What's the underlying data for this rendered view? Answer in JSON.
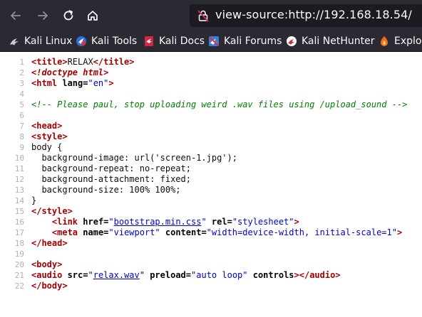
{
  "browser": {
    "url": "view-source:http://192.168.18.54/",
    "icons": {
      "back": "arrow-left-icon",
      "forward": "arrow-right-icon",
      "reload": "reload-icon",
      "home": "home-icon",
      "url": "insecure-lock-icon"
    },
    "bookmarks": [
      {
        "label": "Kali Linux",
        "icon": "kali-dragon-icon"
      },
      {
        "label": "Kali Tools",
        "icon": "kali-tools-icon"
      },
      {
        "label": "Kali Docs",
        "icon": "kali-docs-icon"
      },
      {
        "label": "Kali Forums",
        "icon": "kali-forums-icon"
      },
      {
        "label": "Kali NetHunter",
        "icon": "kali-nethunter-icon"
      },
      {
        "label": "Exploit",
        "icon": "exploit-db-icon"
      }
    ]
  },
  "colors": {
    "toolbar": "#2b2a33",
    "urlbar": "#1c1b22",
    "tag": "#a50000",
    "attribute_value": "#0000c8",
    "comment": "#007f00",
    "line_number": "#b1b1b3"
  },
  "source": {
    "lines": [
      {
        "n": "1",
        "t": [
          [
            "tag",
            "<title>"
          ],
          [
            "text",
            "RELAX"
          ],
          [
            "tag",
            "</title>"
          ]
        ]
      },
      {
        "n": "2",
        "t": [
          [
            "doct",
            "<!doctype html>"
          ]
        ]
      },
      {
        "n": "3",
        "t": [
          [
            "tag",
            "<html "
          ],
          [
            "attr",
            "lang="
          ],
          [
            "val",
            "\"en\""
          ],
          [
            "tag",
            ">"
          ]
        ]
      },
      {
        "n": "4",
        "t": []
      },
      {
        "n": "5",
        "t": [
          [
            "cmt",
            "<!-- Please paul, stop uploading weird .wav files using /upload_sound -->"
          ]
        ]
      },
      {
        "n": "6",
        "t": []
      },
      {
        "n": "7",
        "t": [
          [
            "tag",
            "<head>"
          ]
        ]
      },
      {
        "n": "8",
        "t": [
          [
            "tag",
            "<style>"
          ]
        ]
      },
      {
        "n": "9",
        "t": [
          [
            "text",
            "body {"
          ]
        ]
      },
      {
        "n": "10",
        "t": [
          [
            "text",
            "  background-image: url('screen-1.jpg');"
          ]
        ]
      },
      {
        "n": "11",
        "t": [
          [
            "text",
            "  background-repeat: no-repeat;"
          ]
        ]
      },
      {
        "n": "12",
        "t": [
          [
            "text",
            "  background-attachment: fixed;"
          ]
        ]
      },
      {
        "n": "13",
        "t": [
          [
            "text",
            "  background-size: 100% 100%;"
          ]
        ]
      },
      {
        "n": "14",
        "t": [
          [
            "text",
            "}"
          ]
        ]
      },
      {
        "n": "15",
        "t": [
          [
            "tag",
            "</style>"
          ]
        ]
      },
      {
        "n": "16",
        "t": [
          [
            "text",
            "    "
          ],
          [
            "tag",
            "<link "
          ],
          [
            "attr",
            "href="
          ],
          [
            "val",
            "\""
          ],
          [
            "lnk",
            "bootstrap.min.css"
          ],
          [
            "val",
            "\""
          ],
          [
            "attr",
            " rel="
          ],
          [
            "val",
            "\"stylesheet\""
          ],
          [
            "tag",
            ">"
          ]
        ]
      },
      {
        "n": "17",
        "t": [
          [
            "text",
            "    "
          ],
          [
            "tag",
            "<meta "
          ],
          [
            "attr",
            "name="
          ],
          [
            "val",
            "\"viewport\""
          ],
          [
            "attr",
            " content="
          ],
          [
            "val",
            "\"width=device-width, initial-scale=1\""
          ],
          [
            "tag",
            ">"
          ]
        ]
      },
      {
        "n": "18",
        "t": [
          [
            "tag",
            "</head>"
          ]
        ]
      },
      {
        "n": "19",
        "t": []
      },
      {
        "n": "20",
        "t": [
          [
            "tag",
            "<body>"
          ]
        ]
      },
      {
        "n": "21",
        "t": [
          [
            "tag",
            "<audio "
          ],
          [
            "attr",
            "src="
          ],
          [
            "val",
            "\""
          ],
          [
            "lnk",
            "relax.wav"
          ],
          [
            "val",
            "\""
          ],
          [
            "attr",
            " preload="
          ],
          [
            "val",
            "\"auto loop\""
          ],
          [
            "attr",
            " controls"
          ],
          [
            "tag",
            "></audio>"
          ]
        ]
      },
      {
        "n": "22",
        "t": [
          [
            "tag",
            "</body>"
          ]
        ]
      }
    ]
  }
}
